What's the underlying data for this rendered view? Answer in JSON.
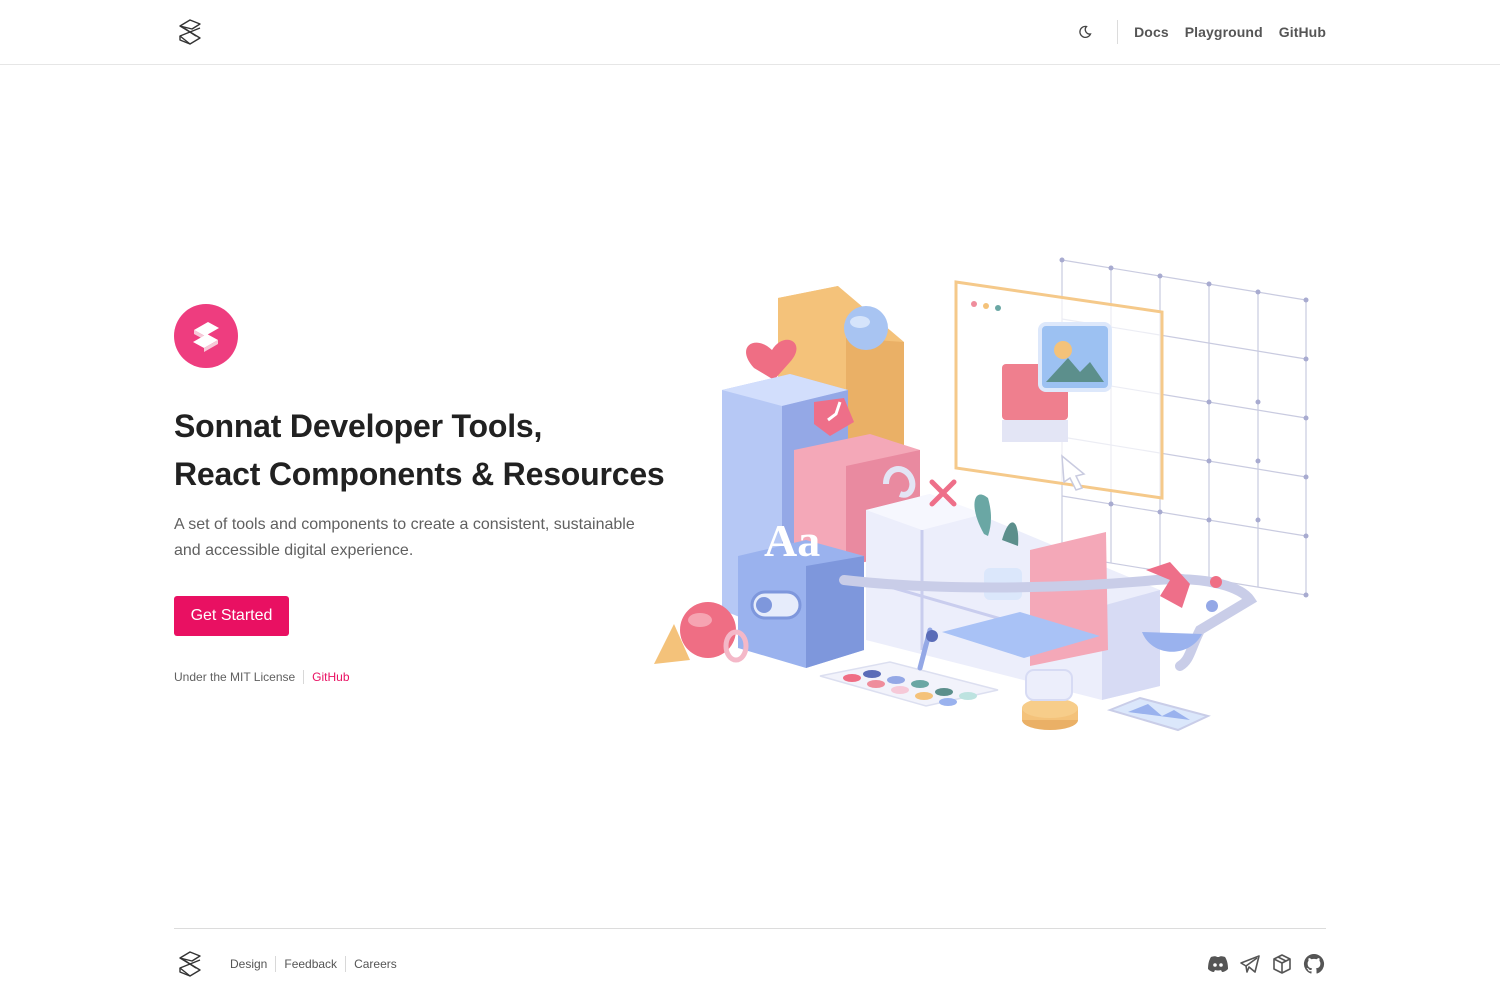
{
  "header": {
    "logo_icon": "sonnat-logo-icon",
    "theme_icon": "moon-icon",
    "nav": [
      {
        "label": "Docs"
      },
      {
        "label": "Playground"
      },
      {
        "label": "GitHub"
      }
    ]
  },
  "hero": {
    "badge_icon": "sonnat-s-icon",
    "title_line1": "Sonnat Developer Tools,",
    "title_line2": "React Components & Resources",
    "description": "A set of tools and components to create a consistent, sustainable and accessible digital experience.",
    "cta_label": "Get Started",
    "license_text": "Under the MIT License",
    "license_link": "GitHub",
    "illustration_icon": "3d-components-illustration"
  },
  "footer": {
    "logo_icon": "sonnat-logo-icon",
    "links": [
      {
        "label": "Design"
      },
      {
        "label": "Feedback"
      },
      {
        "label": "Careers"
      }
    ],
    "social": [
      {
        "icon": "discord-icon"
      },
      {
        "icon": "telegram-icon"
      },
      {
        "icon": "package-icon"
      },
      {
        "icon": "github-icon"
      }
    ]
  },
  "colors": {
    "brand": "#e91062",
    "badge": "#ee3d7f",
    "text": "#212121",
    "muted": "#606060"
  }
}
